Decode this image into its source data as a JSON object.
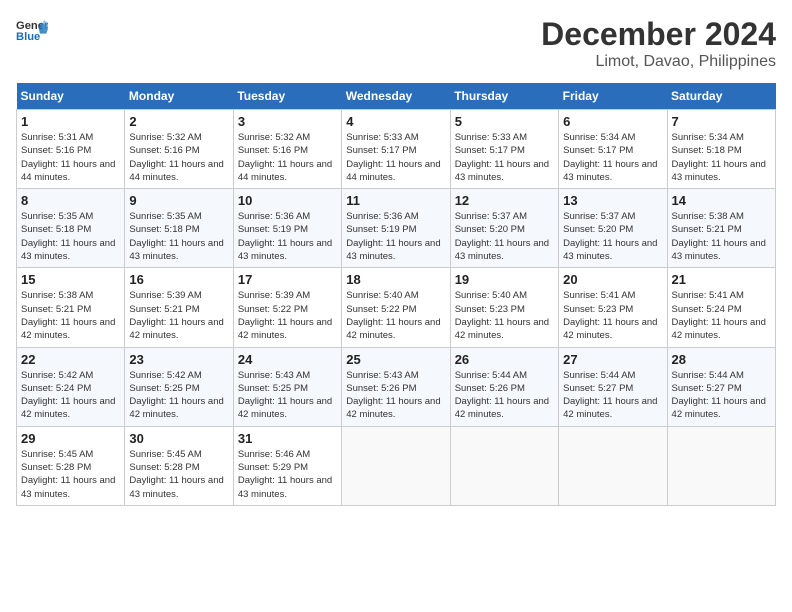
{
  "header": {
    "logo_line1": "General",
    "logo_line2": "Blue",
    "month": "December 2024",
    "location": "Limot, Davao, Philippines"
  },
  "weekdays": [
    "Sunday",
    "Monday",
    "Tuesday",
    "Wednesday",
    "Thursday",
    "Friday",
    "Saturday"
  ],
  "weeks": [
    [
      {
        "day": "1",
        "sunrise": "5:31 AM",
        "sunset": "5:16 PM",
        "daylight": "11 hours and 44 minutes."
      },
      {
        "day": "2",
        "sunrise": "5:32 AM",
        "sunset": "5:16 PM",
        "daylight": "11 hours and 44 minutes."
      },
      {
        "day": "3",
        "sunrise": "5:32 AM",
        "sunset": "5:16 PM",
        "daylight": "11 hours and 44 minutes."
      },
      {
        "day": "4",
        "sunrise": "5:33 AM",
        "sunset": "5:17 PM",
        "daylight": "11 hours and 44 minutes."
      },
      {
        "day": "5",
        "sunrise": "5:33 AM",
        "sunset": "5:17 PM",
        "daylight": "11 hours and 43 minutes."
      },
      {
        "day": "6",
        "sunrise": "5:34 AM",
        "sunset": "5:17 PM",
        "daylight": "11 hours and 43 minutes."
      },
      {
        "day": "7",
        "sunrise": "5:34 AM",
        "sunset": "5:18 PM",
        "daylight": "11 hours and 43 minutes."
      }
    ],
    [
      {
        "day": "8",
        "sunrise": "5:35 AM",
        "sunset": "5:18 PM",
        "daylight": "11 hours and 43 minutes."
      },
      {
        "day": "9",
        "sunrise": "5:35 AM",
        "sunset": "5:18 PM",
        "daylight": "11 hours and 43 minutes."
      },
      {
        "day": "10",
        "sunrise": "5:36 AM",
        "sunset": "5:19 PM",
        "daylight": "11 hours and 43 minutes."
      },
      {
        "day": "11",
        "sunrise": "5:36 AM",
        "sunset": "5:19 PM",
        "daylight": "11 hours and 43 minutes."
      },
      {
        "day": "12",
        "sunrise": "5:37 AM",
        "sunset": "5:20 PM",
        "daylight": "11 hours and 43 minutes."
      },
      {
        "day": "13",
        "sunrise": "5:37 AM",
        "sunset": "5:20 PM",
        "daylight": "11 hours and 43 minutes."
      },
      {
        "day": "14",
        "sunrise": "5:38 AM",
        "sunset": "5:21 PM",
        "daylight": "11 hours and 43 minutes."
      }
    ],
    [
      {
        "day": "15",
        "sunrise": "5:38 AM",
        "sunset": "5:21 PM",
        "daylight": "11 hours and 42 minutes."
      },
      {
        "day": "16",
        "sunrise": "5:39 AM",
        "sunset": "5:21 PM",
        "daylight": "11 hours and 42 minutes."
      },
      {
        "day": "17",
        "sunrise": "5:39 AM",
        "sunset": "5:22 PM",
        "daylight": "11 hours and 42 minutes."
      },
      {
        "day": "18",
        "sunrise": "5:40 AM",
        "sunset": "5:22 PM",
        "daylight": "11 hours and 42 minutes."
      },
      {
        "day": "19",
        "sunrise": "5:40 AM",
        "sunset": "5:23 PM",
        "daylight": "11 hours and 42 minutes."
      },
      {
        "day": "20",
        "sunrise": "5:41 AM",
        "sunset": "5:23 PM",
        "daylight": "11 hours and 42 minutes."
      },
      {
        "day": "21",
        "sunrise": "5:41 AM",
        "sunset": "5:24 PM",
        "daylight": "11 hours and 42 minutes."
      }
    ],
    [
      {
        "day": "22",
        "sunrise": "5:42 AM",
        "sunset": "5:24 PM",
        "daylight": "11 hours and 42 minutes."
      },
      {
        "day": "23",
        "sunrise": "5:42 AM",
        "sunset": "5:25 PM",
        "daylight": "11 hours and 42 minutes."
      },
      {
        "day": "24",
        "sunrise": "5:43 AM",
        "sunset": "5:25 PM",
        "daylight": "11 hours and 42 minutes."
      },
      {
        "day": "25",
        "sunrise": "5:43 AM",
        "sunset": "5:26 PM",
        "daylight": "11 hours and 42 minutes."
      },
      {
        "day": "26",
        "sunrise": "5:44 AM",
        "sunset": "5:26 PM",
        "daylight": "11 hours and 42 minutes."
      },
      {
        "day": "27",
        "sunrise": "5:44 AM",
        "sunset": "5:27 PM",
        "daylight": "11 hours and 42 minutes."
      },
      {
        "day": "28",
        "sunrise": "5:44 AM",
        "sunset": "5:27 PM",
        "daylight": "11 hours and 42 minutes."
      }
    ],
    [
      {
        "day": "29",
        "sunrise": "5:45 AM",
        "sunset": "5:28 PM",
        "daylight": "11 hours and 43 minutes."
      },
      {
        "day": "30",
        "sunrise": "5:45 AM",
        "sunset": "5:28 PM",
        "daylight": "11 hours and 43 minutes."
      },
      {
        "day": "31",
        "sunrise": "5:46 AM",
        "sunset": "5:29 PM",
        "daylight": "11 hours and 43 minutes."
      },
      null,
      null,
      null,
      null
    ]
  ]
}
